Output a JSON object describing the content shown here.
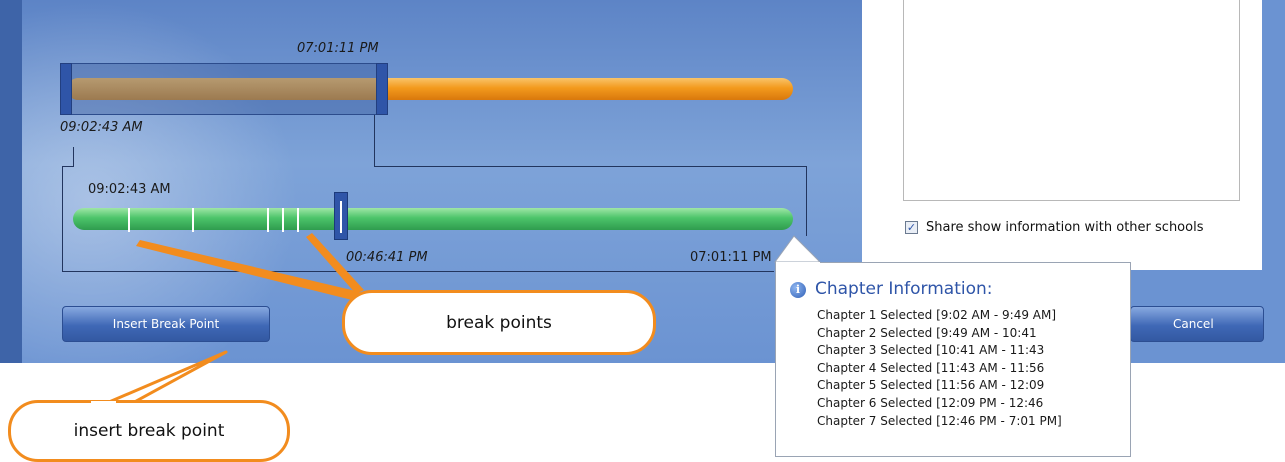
{
  "selector": {
    "top_time": "07:01:11 PM",
    "left_time": "09:02:43 AM"
  },
  "detail": {
    "start_time": "09:02:43 AM",
    "scrubber_time": "00:46:41 PM",
    "end_time": "07:01:11 PM"
  },
  "buttons": {
    "insert": "Insert Break Point",
    "cancel": "Cancel"
  },
  "share": {
    "checked": true,
    "label": "Share show information with other schools"
  },
  "tooltip": {
    "title": "Chapter Information:",
    "chapters": [
      "Chapter 1  Selected  [9:02 AM - 9:49 AM]",
      "Chapter 2  Selected  [9:49 AM - 10:41",
      "Chapter 3  Selected  [10:41 AM - 11:43",
      "Chapter 4  Selected  [11:43 AM - 11:56",
      "Chapter 5  Selected  [11:56 AM - 12:09",
      "Chapter 6  Selected  [12:09 PM - 12:46",
      "Chapter 7  Selected  [12:46 PM - 7:01 PM]"
    ]
  },
  "callouts": {
    "break_points": "break points",
    "insert_break_point": "insert break point"
  },
  "colors": {
    "accent_blue": "#2f55a8",
    "orange": "#f28c1e",
    "green": "#4cc46a"
  }
}
